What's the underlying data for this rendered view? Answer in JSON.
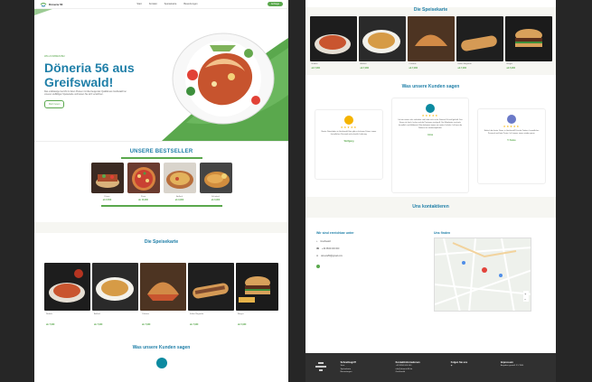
{
  "nav": {
    "brand": "Döneria 56",
    "links": [
      "Start",
      "Kontakt",
      "Speisekarte",
      "Bewertungen"
    ],
    "cta": "Anfrage"
  },
  "hero": {
    "eyebrow": "Willkommen bei",
    "title": "Döneria 56 aus Greifswald!",
    "text": "Das erstklassige Gericht zu fairen Preisen mit überzeugender Qualität aus Greifswald bei unseren vielfältigen Speisekarte und lassen Sie sich verwöhnen.",
    "button": "Mehr lesen"
  },
  "bestseller": {
    "title": "UNSERE BESTSELLER",
    "items": [
      {
        "name": "Döner",
        "price": "ab 6,50€"
      },
      {
        "name": "Pizza",
        "price": "ab 10,90€"
      },
      {
        "name": "Auflauf",
        "price": "ab 9,90€"
      },
      {
        "name": "Schnitzel",
        "price": "ab 6,90€"
      }
    ]
  },
  "menu": {
    "title": "Die Speisekarte",
    "items": [
      {
        "name": "Nudeln",
        "price": "ab 7,90€"
      },
      {
        "name": "Auflauf",
        "price": "ab 7,90€"
      },
      {
        "name": "Calzone",
        "price": "ab 7,90€"
      },
      {
        "name": "Italien Baguette",
        "price": "ab 7,90€"
      },
      {
        "name": "Burger",
        "price": "ab 5,90€"
      }
    ]
  },
  "reviews_left": {
    "title": "Was unsere Kunden sagen"
  },
  "right_top": {
    "title": "Die Speisekarte",
    "items": [
      {
        "name": "Nudeln",
        "price": "ab 7,90€"
      },
      {
        "name": "Auflauf",
        "price": "ab 7,90€"
      },
      {
        "name": "Calzone",
        "price": "ab 7,90€"
      },
      {
        "name": "Italien Baguette",
        "price": "ab 7,90€"
      },
      {
        "name": "Burger",
        "price": "ab 5,90€"
      }
    ]
  },
  "reviews": {
    "title": "Was unsere Kunden sagen",
    "cards": [
      {
        "stars": "★★★★★",
        "text": "Bester Dönerladen in Greifswald. Hier gibt es leckeren Döner, immer freundliches Personal und schnelle Lieferung.",
        "name": "Wolfgang"
      },
      {
        "stars": "★★★★★",
        "text": "Ich war immer sehr zufrieden und habe mich in der Döneria 56 wohl gefühlt. Das Essen ist frisch, lecker und die Portionen sind groß. Die Mitarbeiter sind sehr freundlich und hilfsbereit. Man bekommt immer ein nettes Lächeln. Ich kann die Döneria nur weiterempfehlen.",
        "name": "Anna"
      },
      {
        "stars": "★★★★★",
        "text": "Einfach der beste Döner in Greifswald! Frische Zutaten, freundliches Personal und faire Preise. Ich komme immer wieder gerne.",
        "name": "T. Fanas"
      }
    ]
  },
  "contact": {
    "title": "Uns kontaktieren",
    "reach_title": "Wir sind erreichbar unter",
    "address": "Greifswald",
    "phone": "+49 3834 000 000",
    "email": "doneria56@gmail.com",
    "map_title": "Uns finden"
  },
  "footer": {
    "col1_title": "Schnellzugriff",
    "col1": [
      "Start",
      "Speisekarte",
      "Bewertungen"
    ],
    "col2_title": "Kontaktinformationen",
    "col2": [
      "+49 3834 000 000",
      "info@doneria56.de",
      "Greifswald"
    ],
    "col3_title": "Folgen Sie uns",
    "col4_title": "Impressum",
    "col4": [
      "Angaben gemäß § 5 TMG"
    ]
  }
}
